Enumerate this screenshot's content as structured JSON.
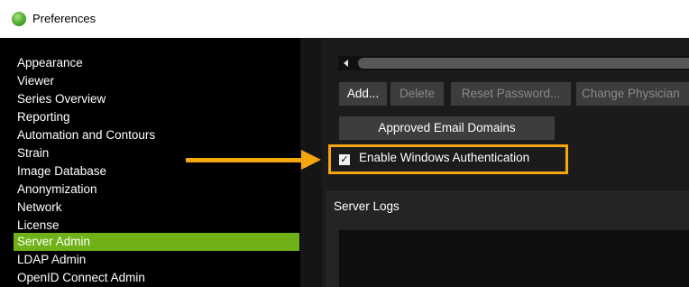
{
  "window": {
    "title": "Preferences",
    "icon": "app-logo-icon"
  },
  "sidebar": {
    "items": [
      {
        "label": "Appearance"
      },
      {
        "label": "Viewer"
      },
      {
        "label": "Series Overview"
      },
      {
        "label": "Reporting"
      },
      {
        "label": "Automation and Contours"
      },
      {
        "label": "Strain"
      },
      {
        "label": "Image Database"
      },
      {
        "label": "Anonymization"
      },
      {
        "label": "Network"
      },
      {
        "label": "License"
      },
      {
        "label": "Server Admin",
        "selected": true
      },
      {
        "label": "LDAP Admin"
      },
      {
        "label": "OpenID Connect Admin"
      }
    ]
  },
  "toolbar": {
    "add_label": "Add...",
    "delete_label": "Delete",
    "reset_password_label": "Reset Password...",
    "change_physician_label": "Change Physician"
  },
  "approved_domains_label": "Approved Email Domains",
  "windows_auth": {
    "label": "Enable Windows Authentication",
    "checked": true
  },
  "server_logs": {
    "label": "Server Logs"
  },
  "colors": {
    "accent_selected": "#6fb117",
    "highlight": "#f6a60d"
  }
}
